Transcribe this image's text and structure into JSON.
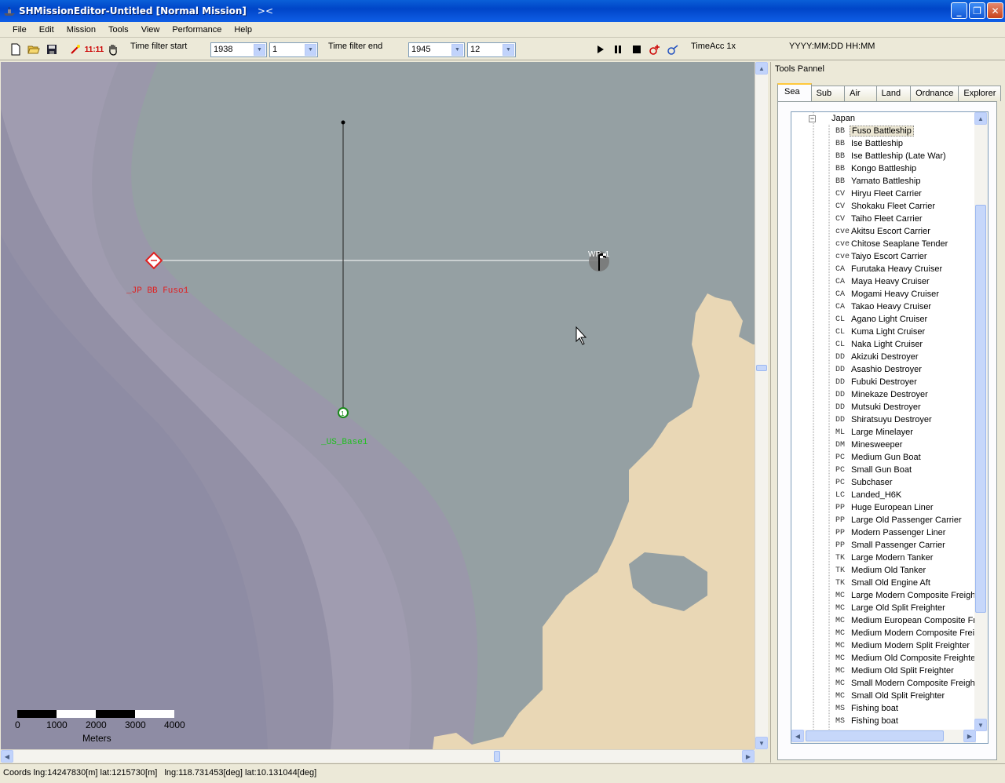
{
  "window": {
    "title": "SHMissionEditor-Untitled [Normal Mission]",
    "title_extra": ">< ",
    "minimize": "_",
    "maximize": "❐",
    "close": "✕"
  },
  "menu": [
    "File",
    "Edit",
    "Mission",
    "Tools",
    "View",
    "Performance",
    "Help"
  ],
  "toolbar": {
    "clock_label": "11:11",
    "time_filter_start_label": "Time filter start",
    "start_year": "1938",
    "start_month": "1",
    "time_filter_end_label": "Time filter end",
    "end_year": "1945",
    "end_month": "12",
    "time_acc": "TimeAcc 1x",
    "datetime_format": "YYYY:MM:DD HH:MM"
  },
  "map": {
    "unit_fuso_label": "_JP BB Fuso1",
    "unit_green_label": "_US_Base1",
    "unit_green_marker": "1",
    "waypoint_label": "WP_1",
    "scale": {
      "ticks": [
        "0",
        "1000",
        "2000",
        "3000",
        "4000"
      ],
      "unit": "Meters"
    },
    "colors": {
      "sea_shallow": "#95a0a3",
      "sea_deep": "#9a98aa",
      "land": "#e9d7b5",
      "enemy": "#e02020",
      "friendly": "#20c020"
    }
  },
  "panel": {
    "title": "Tools Pannel",
    "tabs": [
      "Sea",
      "Sub",
      "Air",
      "Land",
      "Ordnance",
      "Explorer"
    ],
    "active_tab": "Sea",
    "tree_root": "Japan",
    "tree_collapse": "−",
    "items": [
      {
        "cls": "BB",
        "name": "Fuso Battleship"
      },
      {
        "cls": "BB",
        "name": "Ise Battleship"
      },
      {
        "cls": "BB",
        "name": "Ise Battleship (Late War)"
      },
      {
        "cls": "BB",
        "name": "Kongo Battleship"
      },
      {
        "cls": "BB",
        "name": "Yamato Battleship"
      },
      {
        "cls": "CV",
        "name": "Hiryu Fleet Carrier"
      },
      {
        "cls": "CV",
        "name": "Shokaku Fleet Carrier"
      },
      {
        "cls": "CV",
        "name": "Taiho Fleet Carrier"
      },
      {
        "cls": "cve",
        "name": "Akitsu Escort Carrier"
      },
      {
        "cls": "cve",
        "name": "Chitose Seaplane Tender"
      },
      {
        "cls": "cve",
        "name": "Taiyo Escort Carrier"
      },
      {
        "cls": "CA",
        "name": "Furutaka Heavy Cruiser"
      },
      {
        "cls": "CA",
        "name": "Maya Heavy Cruiser"
      },
      {
        "cls": "CA",
        "name": "Mogami Heavy Cruiser"
      },
      {
        "cls": "CA",
        "name": "Takao Heavy Cruiser"
      },
      {
        "cls": "CL",
        "name": "Agano Light Cruiser"
      },
      {
        "cls": "CL",
        "name": "Kuma Light Cruiser"
      },
      {
        "cls": "CL",
        "name": "Naka Light Cruiser"
      },
      {
        "cls": "DD",
        "name": "Akizuki Destroyer"
      },
      {
        "cls": "DD",
        "name": "Asashio Destroyer"
      },
      {
        "cls": "DD",
        "name": "Fubuki Destroyer"
      },
      {
        "cls": "DD",
        "name": "Minekaze Destroyer"
      },
      {
        "cls": "DD",
        "name": "Mutsuki Destroyer"
      },
      {
        "cls": "DD",
        "name": "Shiratsuyu Destroyer"
      },
      {
        "cls": "ML",
        "name": "Large Minelayer"
      },
      {
        "cls": "DM",
        "name": "Minesweeper"
      },
      {
        "cls": "PC",
        "name": "Medium Gun Boat"
      },
      {
        "cls": "PC",
        "name": "Small Gun Boat"
      },
      {
        "cls": "PC",
        "name": "Subchaser"
      },
      {
        "cls": "LC",
        "name": "Landed_H6K"
      },
      {
        "cls": "PP",
        "name": "Huge European Liner"
      },
      {
        "cls": "PP",
        "name": "Large Old Passenger Carrier"
      },
      {
        "cls": "PP",
        "name": "Modern Passenger Liner"
      },
      {
        "cls": "PP",
        "name": "Small Passenger Carrier"
      },
      {
        "cls": "TK",
        "name": "Large Modern Tanker"
      },
      {
        "cls": "TK",
        "name": "Medium Old Tanker"
      },
      {
        "cls": "TK",
        "name": "Small Old Engine Aft"
      },
      {
        "cls": "MC",
        "name": "Large Modern Composite Freighter"
      },
      {
        "cls": "MC",
        "name": "Large Old Split Freighter"
      },
      {
        "cls": "MC",
        "name": "Medium European Composite Freighter"
      },
      {
        "cls": "MC",
        "name": "Medium Modern Composite Freighter"
      },
      {
        "cls": "MC",
        "name": "Medium Modern Split Freighter"
      },
      {
        "cls": "MC",
        "name": "Medium Old Composite Freighter"
      },
      {
        "cls": "MC",
        "name": "Medium Old Split Freighter"
      },
      {
        "cls": "MC",
        "name": "Small Modern Composite Freighter"
      },
      {
        "cls": "MC",
        "name": "Small Old Split Freighter"
      },
      {
        "cls": "MS",
        "name": "Fishing boat"
      },
      {
        "cls": "MS",
        "name": "Fishing boat"
      }
    ]
  },
  "status": {
    "coords": "Coords lng:14247830[m] lat:1215730[m]   lng:118.731453[deg] lat:10.131044[deg]"
  }
}
